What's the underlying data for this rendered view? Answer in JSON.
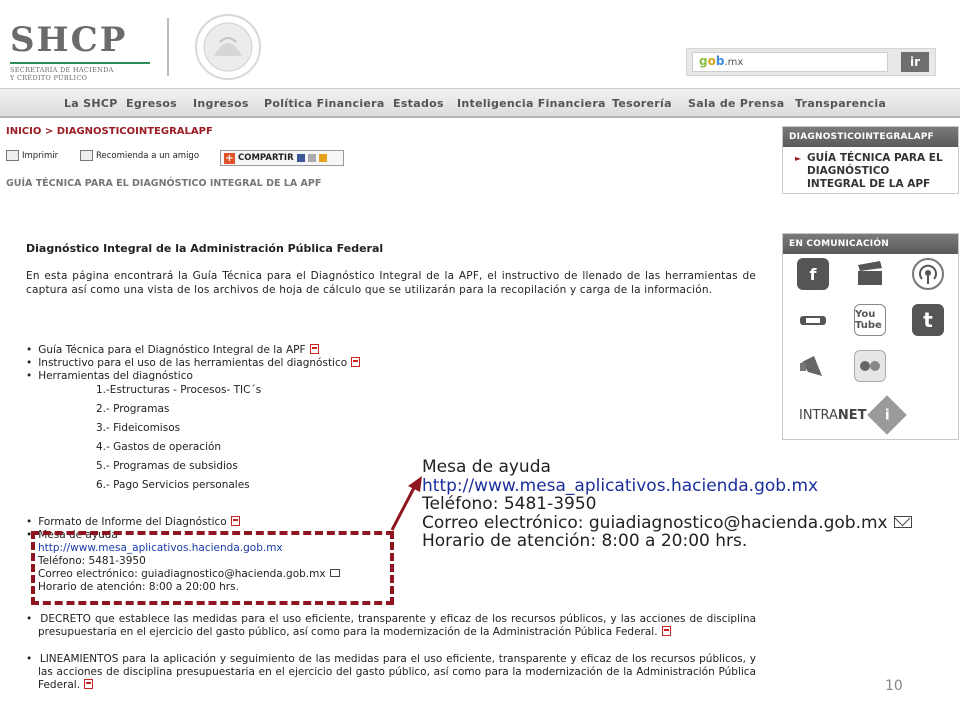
{
  "header": {
    "logo_main": "SHCP",
    "logo_sub_1": "SECRETARÍA DE HACIENDA",
    "logo_sub_2": "Y CRÉDITO PÚBLICO",
    "search_placeholder": "",
    "gob_g": "g",
    "gob_o": "o",
    "gob_b": "b",
    "gob_mx": ".mx",
    "search_button": "ir"
  },
  "nav": {
    "items": [
      "La SHCP",
      "Egresos",
      "Ingresos",
      "Política Financiera",
      "Estados",
      "Inteligencia Financiera",
      "Tesorería",
      "Sala de Prensa",
      "Transparencia"
    ]
  },
  "breadcrumb": "INICIO > DIAGNOSTICOINTEGRALAPF",
  "toolbar": {
    "print": "Imprimir",
    "recommend": "Recomienda a un amigo",
    "share": "COMPARTIR"
  },
  "page_heading": "GUÍA TÉCNICA PARA EL DIAGNÓSTICO INTEGRAL DE LA APF",
  "main": {
    "title": "Diagnóstico Integral de la Administración Pública Federal",
    "intro": "En esta página encontrará la Guía Técnica para el Diagnóstico Integral de la APF, el instructivo de llenado de las herramientas de captura así como una vista de los archivos de hoja de cálculo que se utilizarán para la recopilación y carga de la información.",
    "bullets": [
      "Guía Técnica para el Diagnóstico Integral de la APF",
      "Instructivo para el uso de las herramientas del diagnóstico",
      "Herramientas del diagnóstico"
    ],
    "tools": [
      "1.-Estructuras -  Procesos-  TIC´s",
      "2.- Programas",
      "3.- Fideicomisos",
      "4.- Gastos de operación",
      "5.- Programas de subsidios",
      "6.- Pago Servicios personales"
    ],
    "formato": "Formato de Informe del Diagnóstico",
    "mesa": {
      "title": "Mesa de ayuda",
      "url": "http://www.mesa_aplicativos.hacienda.gob.mx",
      "phone": "Teléfono: 5481-3950",
      "email": "Correo electrónico: guiadiagnostico@hacienda.gob.mx",
      "hours": "Horario de atención: 8:00 a 20:00 hrs."
    },
    "decreto": "DECRETO que establece las medidas para el uso eficiente, transparente y eficaz de los recursos públicos, y las acciones de disciplina presupuestaria en el ejercicio del gasto público, así como para la modernización de la Administración Pública Federal.",
    "lineamientos": "LINEAMIENTOS para la aplicación y seguimiento de las medidas para el uso eficiente, transparente y eficaz de los recursos públicos, y las acciones de disciplina presupuestaria en el ejercicio del gasto público, así como para la modernización de la Administración Pública Federal."
  },
  "callout": {
    "title": "Mesa de ayuda",
    "url": "http://www.mesa_aplicativos.hacienda.gob.mx",
    "phone": "Teléfono: 5481-3950",
    "email": "Correo electrónico: guiadiagnostico@hacienda.gob.mx",
    "hours": "Horario de atención: 8:00 a 20:00 hrs."
  },
  "sidebar": {
    "section1_title": "DIAGNOSTICOINTEGRALAPF",
    "section1_link": "GUÍA TÉCNICA PARA EL DIAGNÓSTICO INTEGRAL DE LA APF",
    "section2_title": "EN COMUNICACIÓN",
    "social_icons": [
      "facebook-icon",
      "video-clapper-icon",
      "podcast-icon",
      "radio-icon",
      "youtube-icon",
      "twitter-icon",
      "megaphone-icon",
      "flickr-icon"
    ],
    "youtube_label": "You Tube",
    "intranet_pre": "INTRA",
    "intranet_bold": "NET",
    "intranet_glyph": "i"
  },
  "slide_number": "10",
  "colors": {
    "accent_red": "#8f1520",
    "link_blue": "#1a3aa8",
    "nav_gray": "#dcdcdc"
  }
}
